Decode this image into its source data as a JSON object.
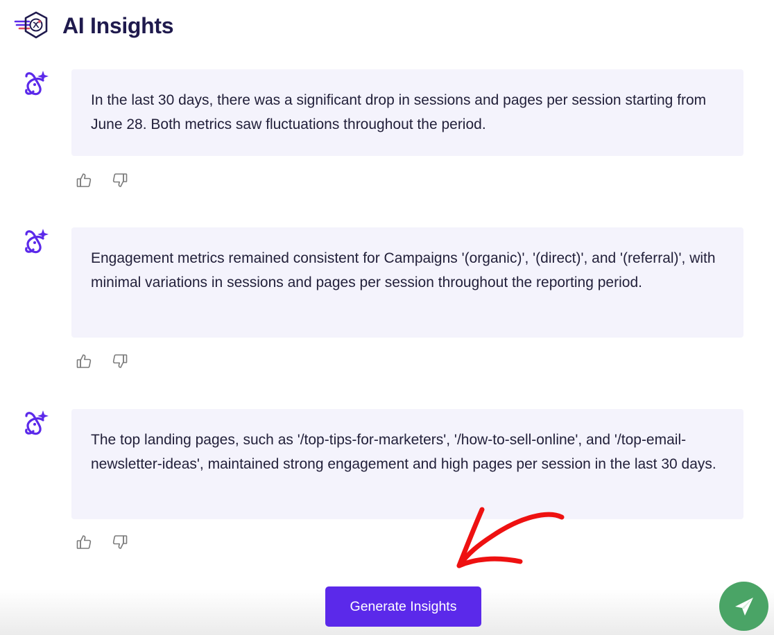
{
  "header": {
    "title": "AI Insights",
    "logo_icon": "ai-insights-hexagon-logo"
  },
  "insights": [
    {
      "icon": "ai-sparkle-icon",
      "text": "In the last 30 days, there was a significant drop in sessions and pages per session starting from June 28. Both metrics saw fluctuations throughout the period.",
      "feedback": {
        "like_icon": "thumbs-up-icon",
        "dislike_icon": "thumbs-down-icon"
      }
    },
    {
      "icon": "ai-sparkle-icon",
      "text": "Engagement metrics remained consistent for Campaigns '(organic)', '(direct)', and '(referral)', with minimal variations in sessions and pages per session throughout the reporting period.",
      "feedback": {
        "like_icon": "thumbs-up-icon",
        "dislike_icon": "thumbs-down-icon"
      }
    },
    {
      "icon": "ai-sparkle-icon",
      "text": "The top landing pages, such as '/top-tips-for-marketers', '/how-to-sell-online', and '/top-email-newsletter-ideas', maintained strong engagement and high pages per session in the last 30 days.",
      "feedback": {
        "like_icon": "thumbs-up-icon",
        "dislike_icon": "thumbs-down-icon"
      }
    }
  ],
  "actions": {
    "generate_label": "Generate Insights",
    "send_icon": "paper-plane-icon"
  },
  "colors": {
    "accent": "#5b29ea",
    "title": "#1f1a4d",
    "bubble_bg": "#f4f3fc",
    "fab_green": "#4aa466",
    "annotation_red": "#ee1111"
  }
}
